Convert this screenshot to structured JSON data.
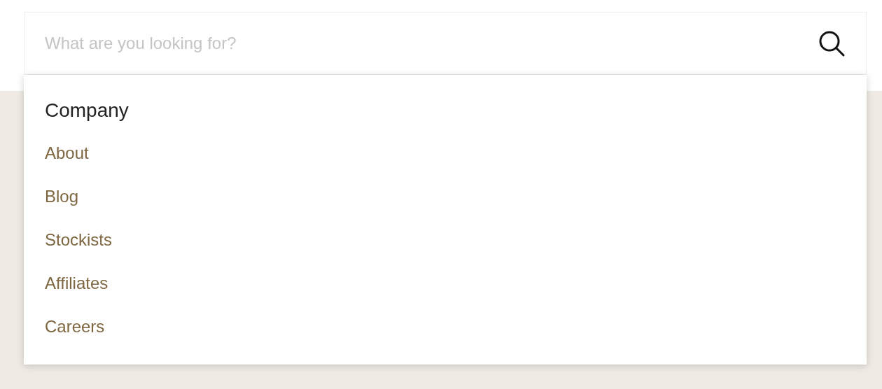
{
  "search": {
    "placeholder": "What are you looking for?"
  },
  "dropdown": {
    "heading": "Company",
    "items": [
      "About",
      "Blog",
      "Stockists",
      "Affiliates",
      "Careers"
    ]
  }
}
